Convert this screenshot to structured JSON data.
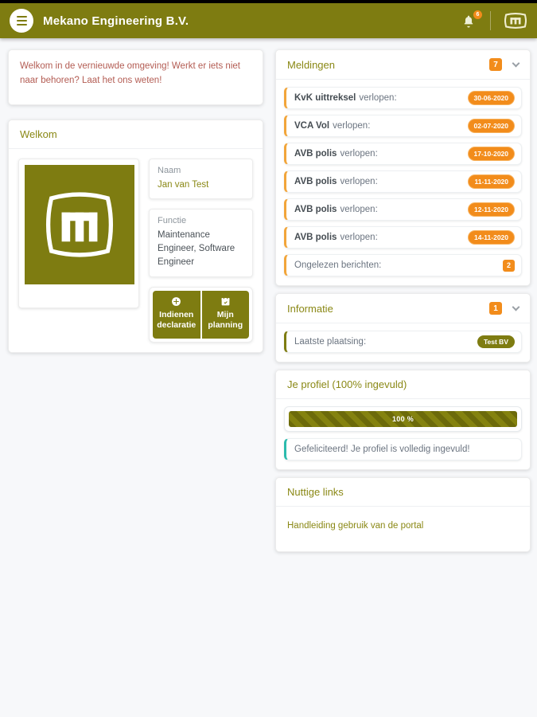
{
  "colors": {
    "primary_olive": "#7e7c11",
    "accent_orange": "#f28c1b",
    "alert_text": "#b35c53",
    "success_teal": "#2bbbad",
    "background": "#f7f8fa"
  },
  "header": {
    "title": "Mekano Engineering B.V.",
    "bell_badge": "6",
    "icons": [
      "hamburger-icon",
      "bell-icon",
      "mekano-logo-icon"
    ]
  },
  "left": {
    "alert_text": "Welkom in de vernieuwde omgeving! Werkt er iets niet naar behoren? Laat het ons weten!",
    "welkom": {
      "title": "Welkom",
      "naam_label": "Naam",
      "naam_value": "Jan van Test",
      "functie_label": "Functie",
      "functie_value": "Maintenance Engineer, Software Engineer",
      "buttons": [
        {
          "label": "Indienen declaratie",
          "icon": "plus-circle-icon"
        },
        {
          "label": "Mijn planning",
          "icon": "calendar-icon"
        }
      ]
    }
  },
  "right": {
    "meldingen": {
      "title": "Meldingen",
      "badge": "7",
      "items": [
        {
          "bold": "KvK uittreksel",
          "text": "verlopen:",
          "badge": "30-06-2020"
        },
        {
          "bold": "VCA Vol",
          "text": "verlopen:",
          "badge": "02-07-2020"
        },
        {
          "bold": "AVB polis",
          "text": "verlopen:",
          "badge": "17-10-2020"
        },
        {
          "bold": "AVB polis",
          "text": "verlopen:",
          "badge": "11-11-2020"
        },
        {
          "bold": "AVB polis",
          "text": "verlopen:",
          "badge": "12-11-2020"
        },
        {
          "bold": "AVB polis",
          "text": "verlopen:",
          "badge": "14-11-2020"
        },
        {
          "bold": "",
          "text": "Ongelezen berichten:",
          "badge": "2"
        }
      ]
    },
    "informatie": {
      "title": "Informatie",
      "badge": "1",
      "item_text": "Laatste plaatsing:",
      "item_badge": "Test BV"
    },
    "profiel": {
      "title": "Je profiel (100% ingevuld)",
      "progress_value": 100,
      "progress_label": "100 %",
      "success_text": "Gefeliciteerd! Je profiel is volledig ingevuld!"
    },
    "links": {
      "title": "Nuttige links",
      "link_label": "Handleiding gebruik van de portal"
    }
  }
}
